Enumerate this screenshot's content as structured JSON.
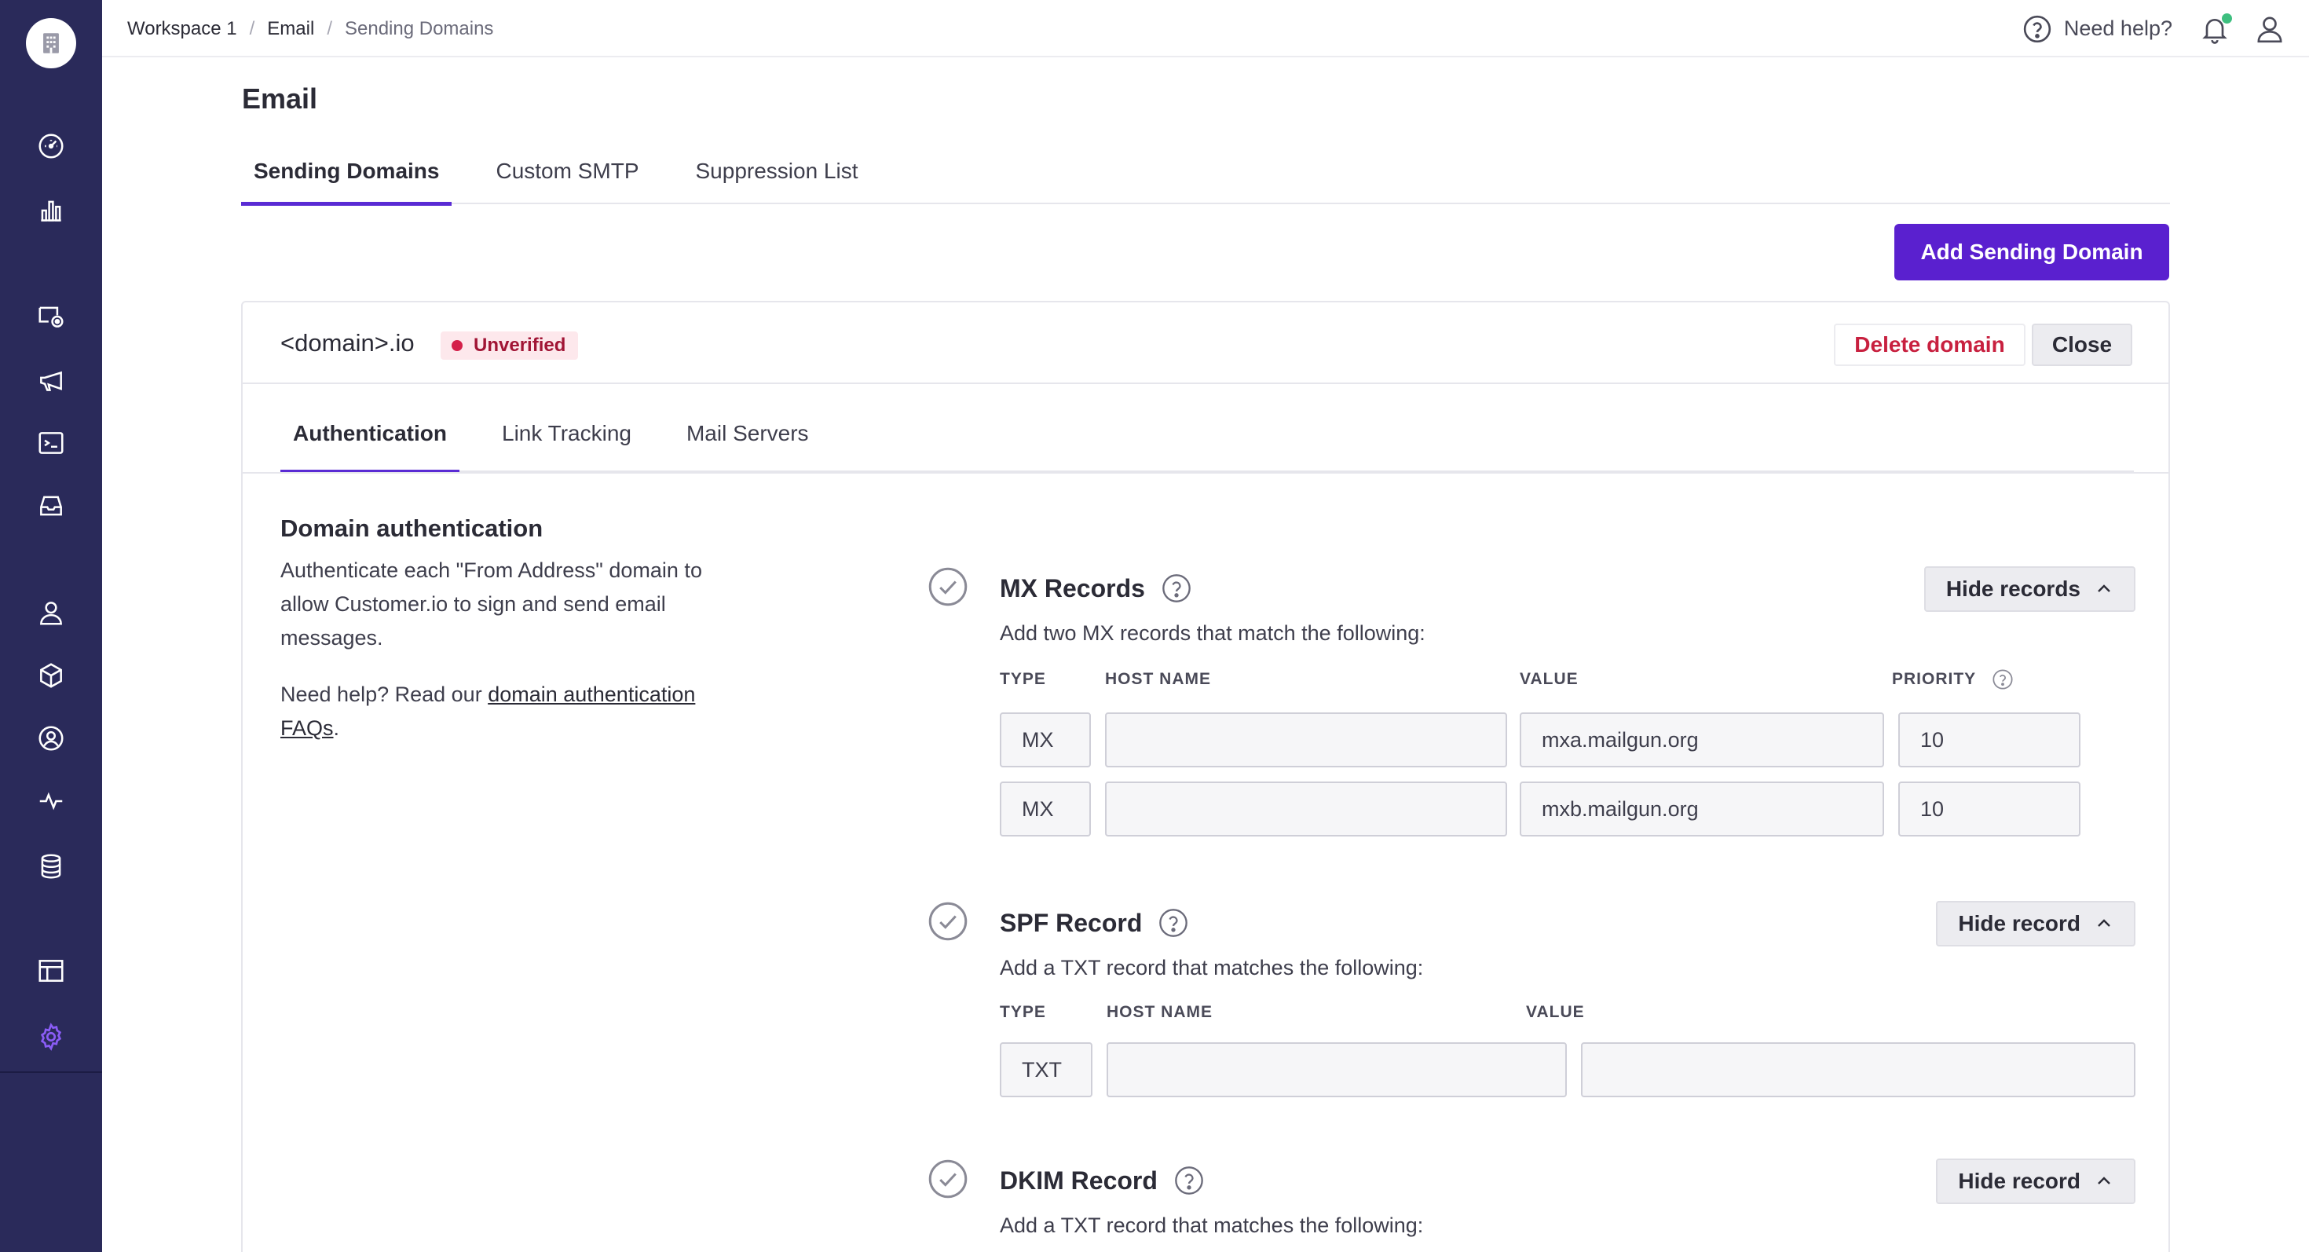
{
  "breadcrumb": [
    "Workspace 1",
    "Email",
    "Sending Domains"
  ],
  "topbar": {
    "help_label": "Need help?"
  },
  "page": {
    "title": "Email"
  },
  "tabs": [
    "Sending Domains",
    "Custom SMTP",
    "Suppression List"
  ],
  "add_button": "Add Sending Domain",
  "domain": {
    "name": "<domain>.io",
    "status": "Unverified",
    "delete_label": "Delete domain",
    "close_label": "Close",
    "tabs": [
      "Authentication",
      "Link Tracking",
      "Mail Servers"
    ]
  },
  "auth": {
    "title": "Domain authentication",
    "description": "Authenticate each \"From Address\" domain to allow Customer.io to sign and send email messages.",
    "help_prefix": "Need help? Read our ",
    "help_link": "domain authentication FAQs",
    "help_suffix": "."
  },
  "columns": {
    "type": "TYPE",
    "host": "HOST NAME",
    "value": "VALUE",
    "priority": "PRIORITY"
  },
  "mx": {
    "title": "MX Records",
    "toggle": "Hide records",
    "subtitle": "Add two MX records that match the following:",
    "rows": [
      {
        "type": "MX",
        "host": "",
        "value": "mxa.mailgun.org",
        "priority": "10"
      },
      {
        "type": "MX",
        "host": "",
        "value": "mxb.mailgun.org",
        "priority": "10"
      }
    ]
  },
  "spf": {
    "title": "SPF Record",
    "toggle": "Hide record",
    "subtitle": "Add a TXT record that matches the following:",
    "row": {
      "type": "TXT",
      "host": "",
      "value": ""
    }
  },
  "dkim": {
    "title": "DKIM Record",
    "toggle": "Hide record",
    "subtitle": "Add a TXT record that matches the following:"
  },
  "colors": {
    "sidebar": "#2a2a5a",
    "primary": "#5a20cf",
    "danger": "#c8203f",
    "active_settings": "#8a5cf6"
  }
}
